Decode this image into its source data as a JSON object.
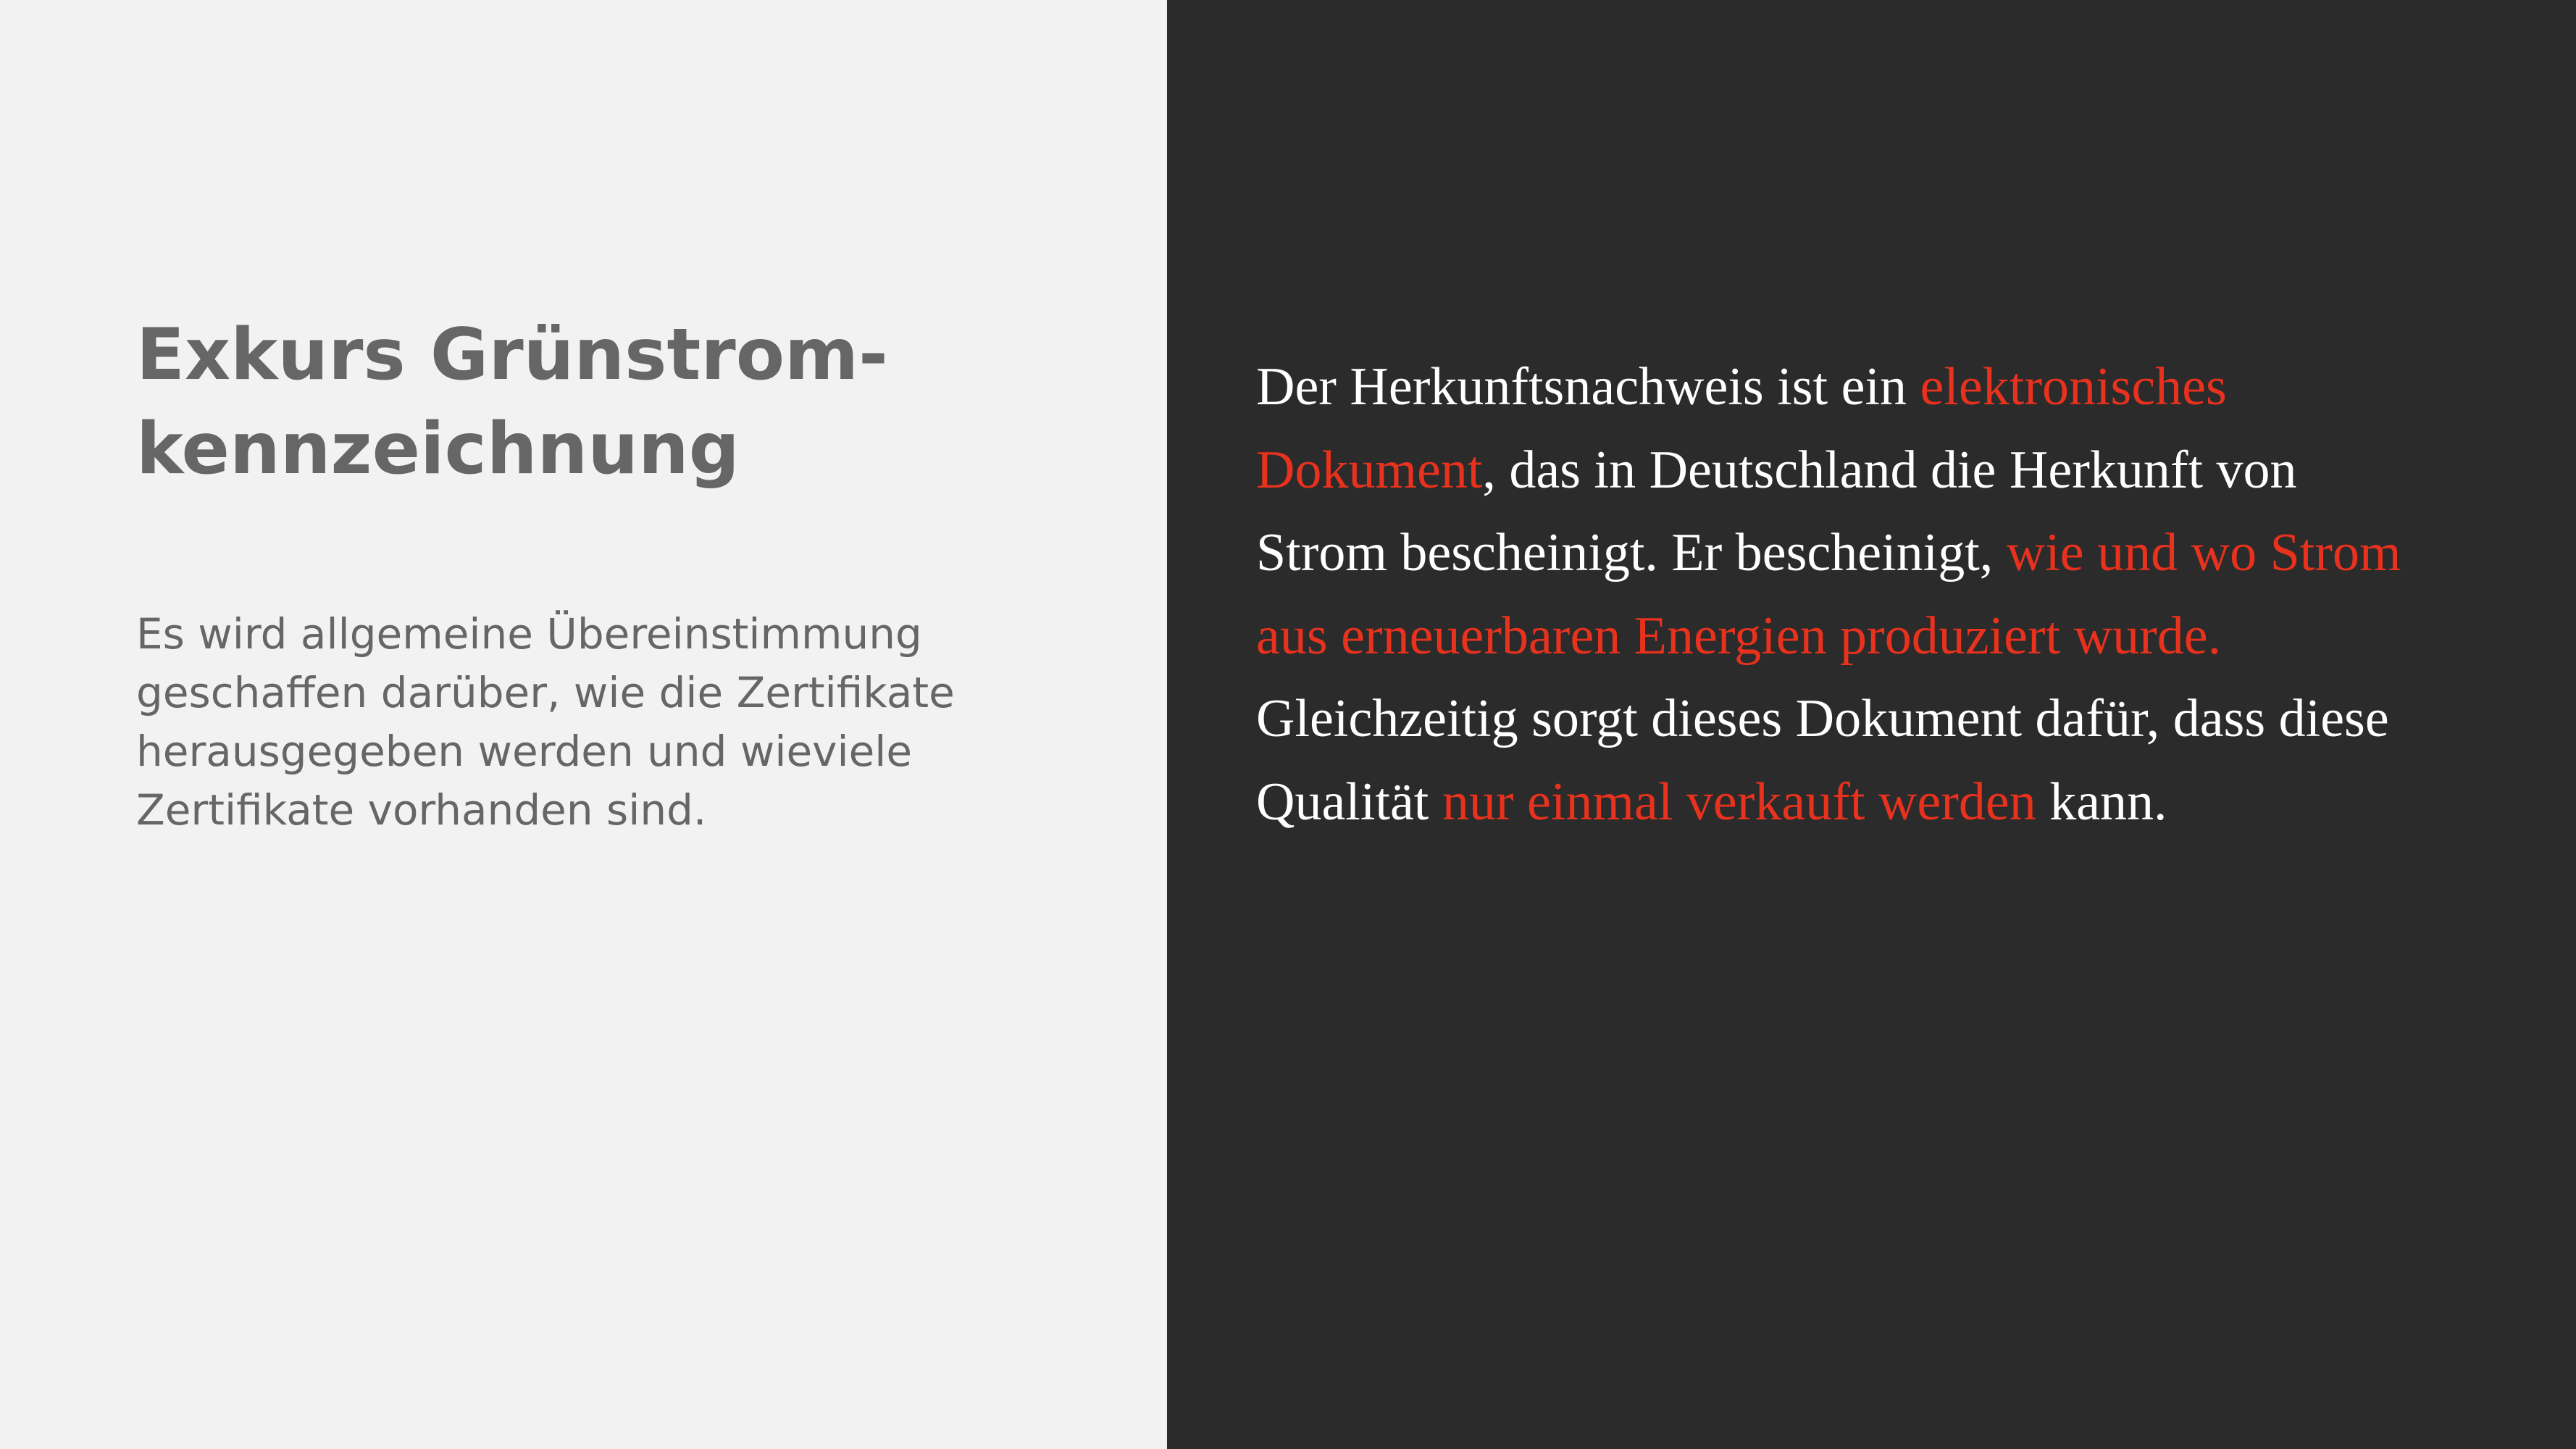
{
  "heading": {
    "line1": "Exkurs Grünstrom-",
    "line2": "kennzeichnung"
  },
  "intro": {
    "lines": [
      "Es wird allgemeine Übereinstimmung",
      "geschaffen darüber, wie die Zertifikate",
      "herausgegeben werden und wieviele",
      "Zertifikate vorhanden sind."
    ]
  },
  "body": {
    "l1_a": "Der Herkunftsnachweis ist ein ",
    "l1_b": "elektronisches",
    "l2_a": "Dokument",
    "l2_b": ", das in Deutschland die Herkunft von",
    "l3_a": "Strom bescheinigt. Er bescheinigt, ",
    "l3_b": "wie und wo Strom",
    "l4_a": "aus erneuerbaren Energien produziert wurde.",
    "l5_a": "Gleichzeitig sorgt dieses Dokument dafür, dass diese",
    "l6_a": "Qualität ",
    "l6_b": "nur einmal verkauft werden",
    "l6_c": " kann."
  },
  "colors": {
    "left_background": "#f2f2f2",
    "right_background": "#2b2b2b",
    "heading_text": "#666666",
    "body_text": "#ffffff",
    "highlight": "#e8321e"
  }
}
